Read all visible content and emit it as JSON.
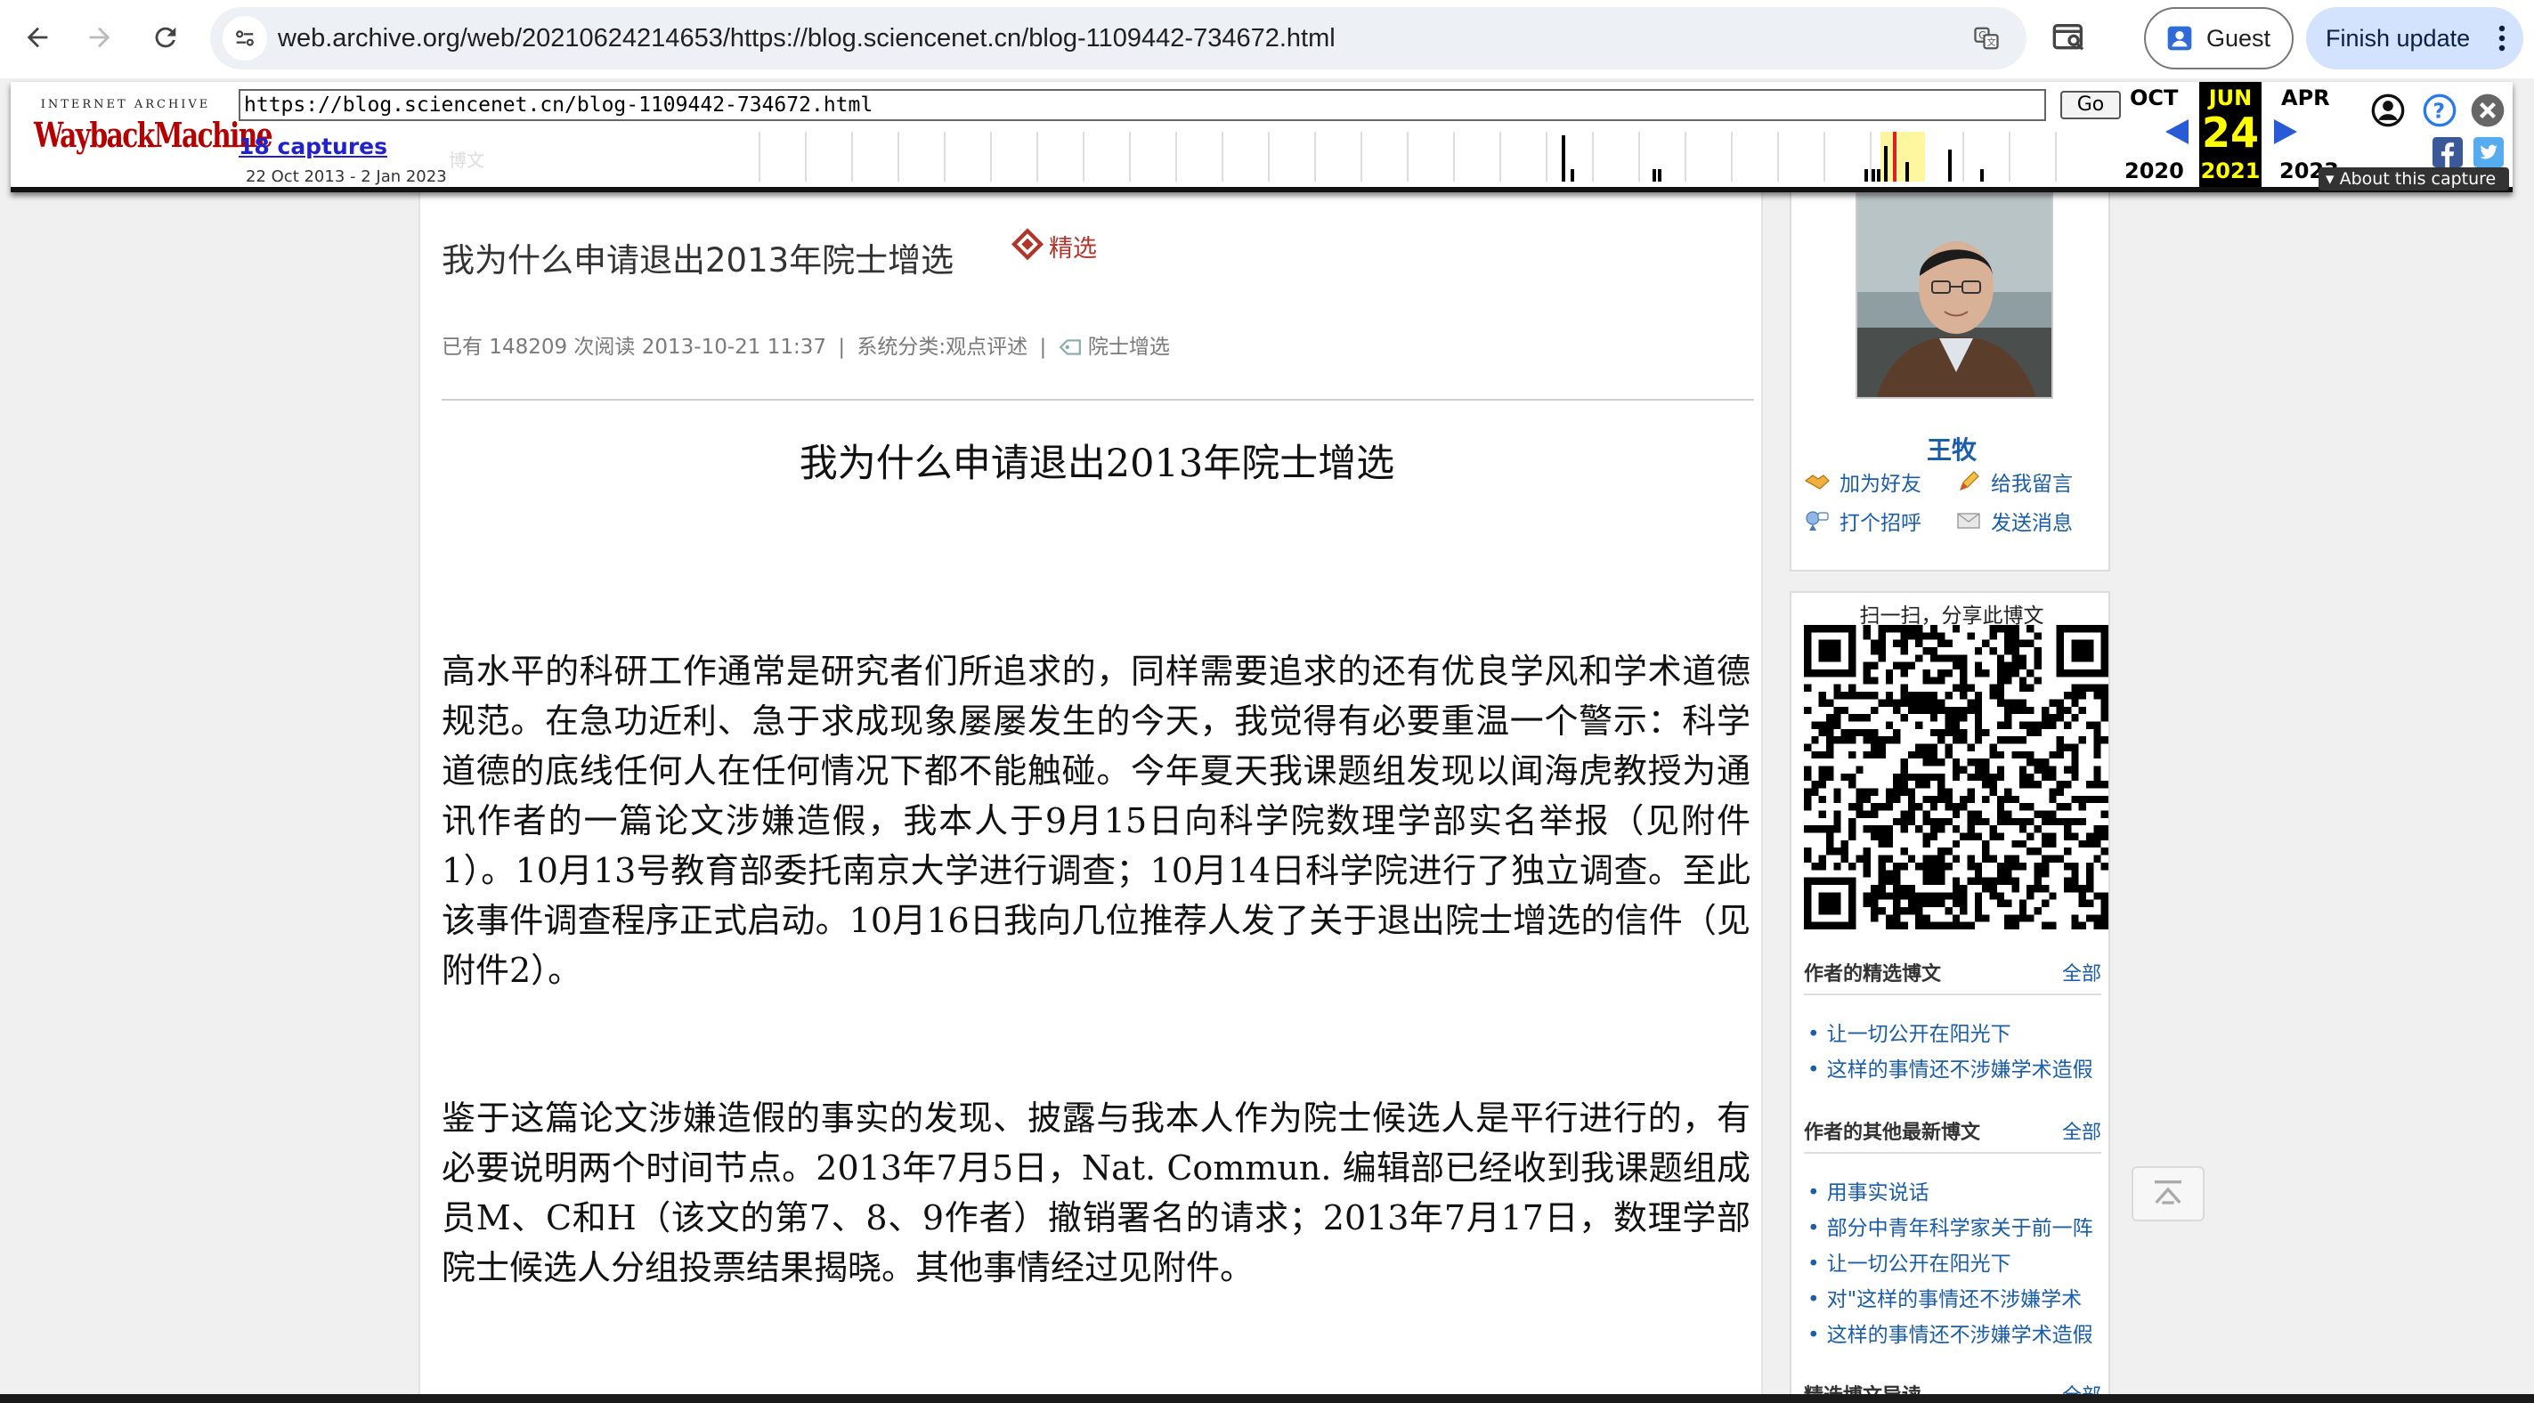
{
  "browser": {
    "url": "web.archive.org/web/20210624214653/https://blog.sciencenet.cn/blog-1109442-734672.html",
    "guest_label": "Guest",
    "finish_update_label": "Finish update"
  },
  "wayback": {
    "logo_top": "INTERNET ARCHIVE",
    "logo_main": "WaybackMachine",
    "url_value": "https://blog.sciencenet.cn/blog-1109442-734672.html",
    "go_label": "Go",
    "captures_label": "18 captures",
    "date_range": "22 Oct 2013 - 2 Jan 2023",
    "prev_month": "OCT",
    "cur_month": "JUN",
    "next_month": "APR",
    "cur_day": "24",
    "prev_year": "2020",
    "cur_year": "2021",
    "next_year": "2023",
    "about_label": "About this capture",
    "hidden_text": "博文"
  },
  "post": {
    "title": "我为什么申请退出2013年院士增选",
    "featured_label": "精选",
    "meta_reads": "已有 148209 次阅读",
    "meta_date": "2013-10-21 11:37",
    "meta_category": "系统分类:观点评述",
    "meta_tag": "院士增选",
    "article_heading": "我为什么申请退出2013年院士增选",
    "paragraph_1": "高水平的科研工作通常是研究者们所追求的，同样需要追求的还有优良学风和学术道德规范。在急功近利、急于求成现象屡屡发生的今天，我觉得有必要重温一个警示：科学道德的底线任何人在任何情况下都不能触碰。今年夏天我课题组发现以闻海虎教授为通讯作者的一篇论文涉嫌造假，我本人于9月15日向科学院数理学部实名举报（见附件1）。10月13号教育部委托南京大学进行调查；10月14日科学院进行了独立调查。至此该事件调查程序正式启动。10月16日我向几位推荐人发了关于退出院士增选的信件（见附件2）。",
    "paragraph_2": "鉴于这篇论文涉嫌造假的事实的发现、披露与我本人作为院士候选人是平行进行的，有必要说明两个时间节点。2013年7月5日，Nat. Commun. 编辑部已经收到我课题组成员M、C和H（该文的第7、8、9作者）撤销署名的请求；2013年7月17日，数理学部院士候选人分组投票结果揭晓。其他事情经过见附件。"
  },
  "sidebar": {
    "author_name": "王牧",
    "add_friend": "加为好友",
    "leave_message": "给我留言",
    "say_hello": "打个招呼",
    "send_message": "发送消息",
    "qr_caption": "扫一扫，分享此博文",
    "featured_section": "作者的精选博文",
    "all_label": "全部",
    "featured_items": [
      "让一切公开在阳光下",
      "这样的事情还不涉嫌学术造假"
    ],
    "latest_section": "作者的其他最新博文",
    "latest_items": [
      "用事实说话",
      "部分中青年科学家关于前一阵",
      "让一切公开在阳光下",
      "对\"这样的事情还不涉嫌学术",
      "这样的事情还不涉嫌学术造假"
    ],
    "guide_section": "精选博文导读"
  },
  "colors": {
    "link_blue": "#1a5da8",
    "featured_red": "#b0362c",
    "wayback_red": "#b40000",
    "highlight_yellow": "#ffff00"
  },
  "icons": [
    "back-arrow-icon",
    "forward-arrow-icon",
    "reload-icon",
    "site-info-icon",
    "translate-icon",
    "tab-search-icon",
    "profile-icon",
    "more-vert-icon",
    "help-icon",
    "close-icon",
    "facebook-icon",
    "twitter-icon",
    "featured-badge-icon",
    "tag-icon",
    "back-to-top-icon"
  ]
}
